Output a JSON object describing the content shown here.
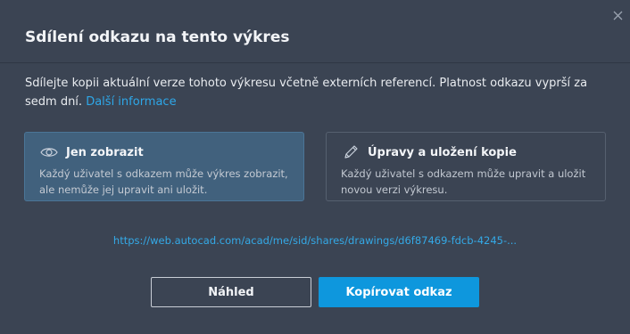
{
  "dialog": {
    "title": "Sdílení odkazu na tento výkres",
    "description": "Sdílejte kopii aktuální verze tohoto výkresu včetně externích referencí. Platnost odkazu vyprší za sedm dní.",
    "more_info_link": "Další informace",
    "close_icon": "close-icon"
  },
  "options": [
    {
      "icon": "eye-icon",
      "title": "Jen zobrazit",
      "description": "Každý uživatel s odkazem může výkres zobrazit, ale nemůže jej upravit ani uložit.",
      "selected": true
    },
    {
      "icon": "pencil-icon",
      "title": "Úpravy a uložení kopie",
      "description": "Každý uživatel s odkazem může upravit a uložit novou verzi výkresu.",
      "selected": false
    }
  ],
  "share_link": "https://web.autocad.com/acad/me/sid/shares/drawings/d6f87469-fdcb-4245-...",
  "buttons": {
    "preview_label": "Náhled",
    "copy_label": "Kopírovat odkaz"
  },
  "colors": {
    "background": "#3b4453",
    "selected_option": "#41617d",
    "accent": "#0e97dd",
    "link": "#2ea7e8"
  }
}
